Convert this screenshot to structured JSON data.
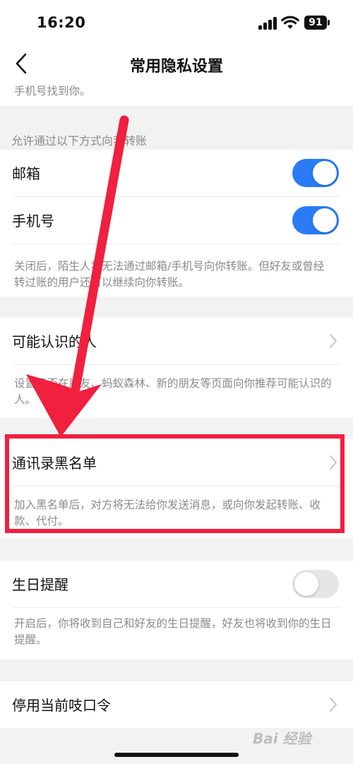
{
  "status_bar": {
    "time": "16:20",
    "battery": "91"
  },
  "header": {
    "title": "常用隐私设置"
  },
  "top_desc": "手机号找到你。",
  "transfer": {
    "group_label": "允许通过以下方式向我转账",
    "rows": [
      {
        "label": "邮箱",
        "enabled": true
      },
      {
        "label": "手机号",
        "enabled": true
      }
    ],
    "desc": "关闭后，陌生人将无法通过邮箱/手机号向你转账。但好友或曾经转过账的用户还可以继续向你转账。"
  },
  "people": {
    "label": "可能认识的人",
    "desc": "设置是否在朋友、蚂蚁森林、新的朋友等页面向你推荐可能认识的人。"
  },
  "blacklist": {
    "label": "通讯录黑名单",
    "desc": "加入黑名单后，对方将无法给你发送消息，或向你发起转账、收款、代付。"
  },
  "birthday": {
    "label": "生日提醒",
    "enabled": false,
    "desc": "开启后，你将收到自己和好友的生日提醒，好友也将收到你的生日提醒。"
  },
  "passcode": {
    "label": "停用当前吱口令"
  },
  "watermark": "Bai 经验",
  "colors": {
    "accent": "#2a7bf6",
    "annotation": "#f0203e",
    "background": "#f2f2f2"
  }
}
